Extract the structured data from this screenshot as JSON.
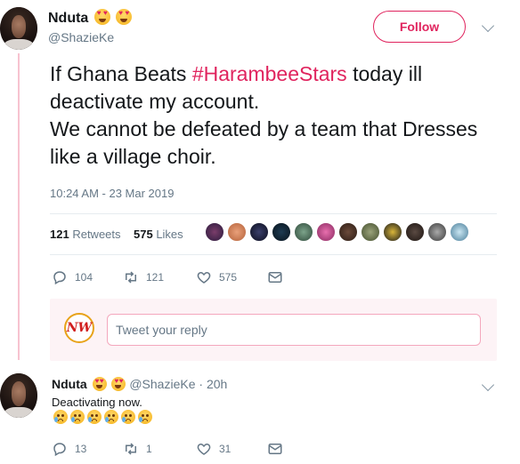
{
  "main_tweet": {
    "author_name": "Nduta",
    "author_handle": "@ShazieKe",
    "follow_label": "Follow",
    "text_before_hashtag": "If Ghana Beats ",
    "hashtag": "#HarambeeStars",
    "text_after_hashtag": " today ill deactivate my account.",
    "text_line_2": "We cannot be defeated by a team that Dresses like a village choir.",
    "timestamp": "10:24 AM - 23 Mar 2019",
    "retweet_count": "121",
    "retweets_label": "Retweets",
    "like_count": "575",
    "likes_label": "Likes",
    "reply_count": "104",
    "actions_retweet_count": "121",
    "actions_like_count": "575"
  },
  "reply_composer": {
    "avatar_text": "NW",
    "placeholder": "Tweet your reply"
  },
  "reply_tweet": {
    "author_name": "Nduta",
    "author_handle": "@ShazieKe",
    "time": "· 20h",
    "text": "Deactivating now.",
    "reply_count": "13",
    "retweet_count": "1",
    "like_count": "31"
  },
  "colors": {
    "accent": "#e0245e",
    "muted": "#657786",
    "thread_line": "#f7c3d0"
  }
}
